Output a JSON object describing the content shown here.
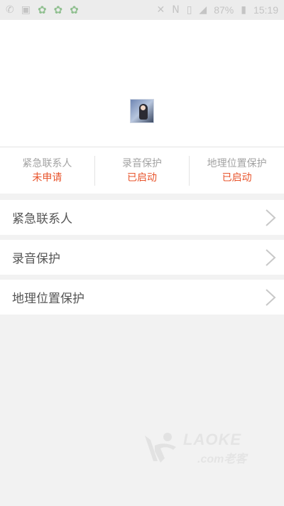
{
  "status_bar": {
    "battery_percent": "87%",
    "time": "15:19",
    "icons_left": [
      "whatsapp-icon",
      "image-icon",
      "app-icon",
      "app-icon",
      "app-icon"
    ],
    "icons_right": [
      "mute-icon",
      "nfc-icon",
      "vibrate-icon",
      "signal-icon",
      "battery-icon"
    ]
  },
  "summary": [
    {
      "label": "紧急联系人",
      "value": "未申请"
    },
    {
      "label": "录音保护",
      "value": "已启动"
    },
    {
      "label": "地理位置保护",
      "value": "已启动"
    }
  ],
  "menu": [
    {
      "label": "紧急联系人"
    },
    {
      "label": "录音保护"
    },
    {
      "label": "地理位置保护"
    }
  ],
  "watermark": {
    "main": "LAOKE",
    "sub": ".com老客"
  },
  "colors": {
    "accent": "#e8542c",
    "label_gray": "#a3a3a3",
    "row_text": "#555555",
    "background": "#f2f2f2"
  }
}
